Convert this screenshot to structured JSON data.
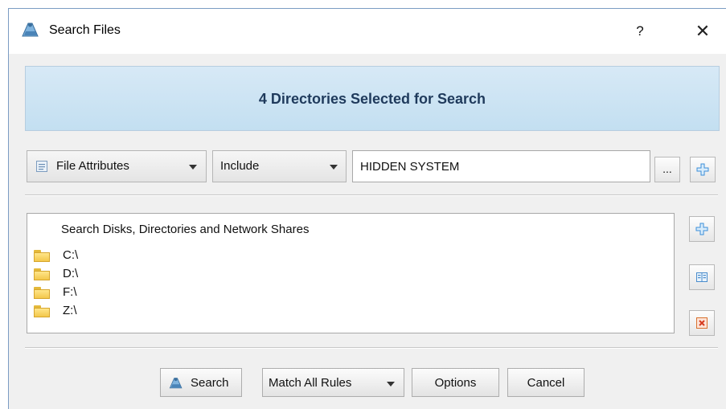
{
  "window": {
    "title": "Search Files",
    "help_glyph": "?",
    "close_glyph": "✕"
  },
  "banner": {
    "text": "4 Directories Selected for Search"
  },
  "filter": {
    "attribute_combo": {
      "label": "File Attributes",
      "icon": "file-attributes-icon"
    },
    "mode_combo": {
      "label": "Include"
    },
    "value_input": {
      "value": "HIDDEN SYSTEM"
    },
    "browse_label": "...",
    "add_rule_icon": "plus-icon"
  },
  "locations": {
    "header": "Search Disks, Directories and Network Shares",
    "items": [
      {
        "label": "C:\\",
        "icon": "folder-icon"
      },
      {
        "label": "D:\\",
        "icon": "folder-icon"
      },
      {
        "label": "F:\\",
        "icon": "folder-icon"
      },
      {
        "label": "Z:\\",
        "icon": "folder-icon"
      }
    ],
    "side_buttons": [
      "plus-icon",
      "columns-icon",
      "delete-icon"
    ]
  },
  "actions": {
    "search_label": "Search",
    "match_label": "Match All Rules",
    "options_label": "Options",
    "cancel_label": "Cancel"
  },
  "colors": {
    "banner_text": "#1f3a5c",
    "banner_bg": "#c3dff1",
    "accent_blue": "#3b8ed8"
  }
}
